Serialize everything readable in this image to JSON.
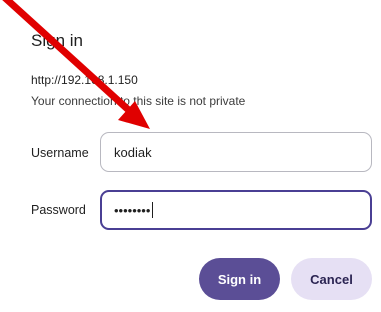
{
  "dialog": {
    "title": "Sign in",
    "host": "http://192.168.1.150",
    "notice": "Your connection to this site is not private",
    "username_label": "Username",
    "username_value": "kodiak",
    "password_label": "Password",
    "password_masked": "••••••••",
    "sign_in_label": "Sign in",
    "cancel_label": "Cancel"
  },
  "annotation": {
    "arrow_color": "#e00000"
  },
  "colors": {
    "accent": "#5b4e96",
    "focus_border": "#4a3f94",
    "secondary_button": "#e6e0f4"
  }
}
